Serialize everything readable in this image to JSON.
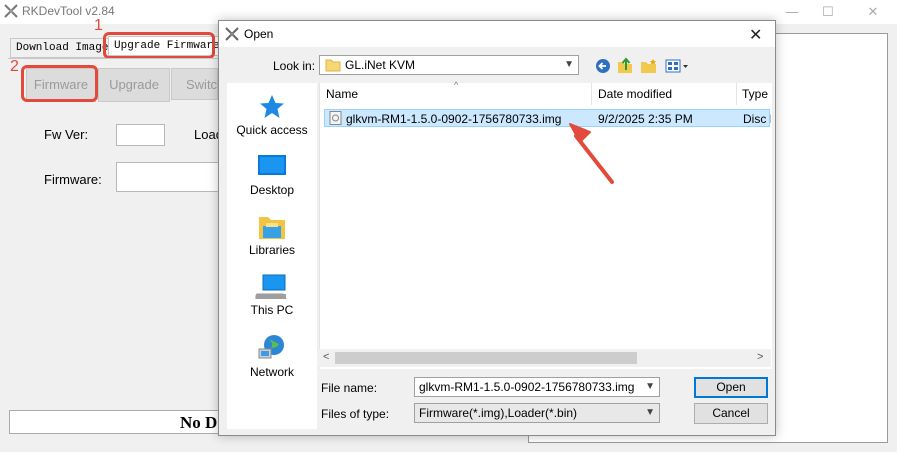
{
  "app": {
    "title": "RKDevTool v2.84",
    "tabs": [
      "Download Image",
      "Upgrade Firmware"
    ],
    "subtabs": [
      "Firmware",
      "Upgrade",
      "Switch"
    ],
    "fw_ver_label": "Fw Ver:",
    "loader_label": "Load",
    "firmware_label": "Firmware:",
    "status_text": "No D",
    "annotation_1": "1",
    "annotation_2": "2"
  },
  "dialog": {
    "title": "Open",
    "look_in_label": "Look in:",
    "look_in_value": "GL.iNet KVM",
    "places": [
      "Quick access",
      "Desktop",
      "Libraries",
      "This PC",
      "Network"
    ],
    "columns": [
      "Name",
      "Date modified",
      "Type"
    ],
    "files": [
      {
        "name": "glkvm-RM1-1.5.0-0902-1756780733.img",
        "date": "9/2/2025 2:35 PM",
        "type": "Disc I"
      }
    ],
    "file_name_label": "File name:",
    "file_name_value": "glkvm-RM1-1.5.0-0902-1756780733.img",
    "files_of_type_label": "Files of type:",
    "files_of_type_value": "Firmware(*.img),Loader(*.bin)",
    "open_label": "Open",
    "cancel_label": "Cancel"
  },
  "colors": {
    "annotation": "#e24b3b",
    "selection": "#cce8ff",
    "accent": "#0078d7"
  }
}
